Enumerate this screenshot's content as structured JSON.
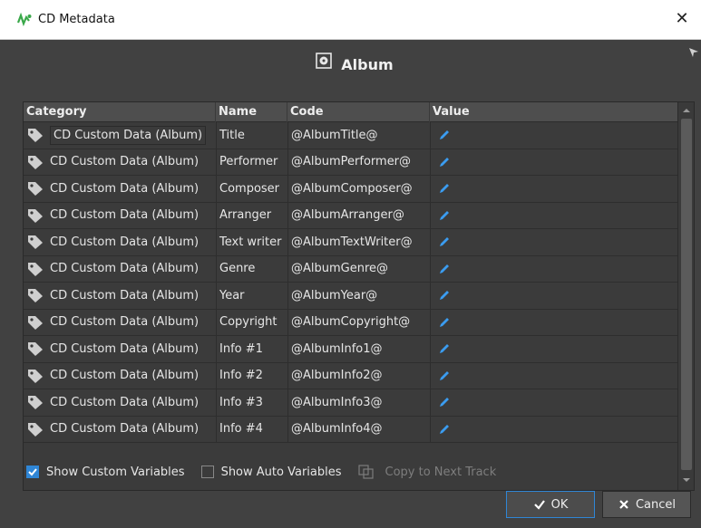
{
  "window": {
    "title": "CD Metadata",
    "close_icon": "close-icon",
    "app_icon": "wavelab-logo-icon"
  },
  "header": {
    "title": "Album",
    "icon": "album-icon"
  },
  "table": {
    "columns": [
      "Category",
      "Name",
      "Code",
      "Value"
    ],
    "rows": [
      {
        "category": "CD Custom Data (Album)",
        "name": "Title",
        "code": "@AlbumTitle@"
      },
      {
        "category": "CD Custom Data (Album)",
        "name": "Performer",
        "code": "@AlbumPerformer@"
      },
      {
        "category": "CD Custom Data (Album)",
        "name": "Composer",
        "code": "@AlbumComposer@"
      },
      {
        "category": "CD Custom Data (Album)",
        "name": "Arranger",
        "code": "@AlbumArranger@"
      },
      {
        "category": "CD Custom Data (Album)",
        "name": "Text writer",
        "code": "@AlbumTextWriter@"
      },
      {
        "category": "CD Custom Data (Album)",
        "name": "Genre",
        "code": "@AlbumGenre@"
      },
      {
        "category": "CD Custom Data (Album)",
        "name": "Year",
        "code": "@AlbumYear@"
      },
      {
        "category": "CD Custom Data (Album)",
        "name": "Copyright",
        "code": "@AlbumCopyright@"
      },
      {
        "category": "CD Custom Data (Album)",
        "name": "Info #1",
        "code": "@AlbumInfo1@"
      },
      {
        "category": "CD Custom Data (Album)",
        "name": "Info #2",
        "code": "@AlbumInfo2@"
      },
      {
        "category": "CD Custom Data (Album)",
        "name": "Info #3",
        "code": "@AlbumInfo3@"
      },
      {
        "category": "CD Custom Data (Album)",
        "name": "Info #4",
        "code": "@AlbumInfo4@"
      }
    ]
  },
  "options": {
    "show_custom_variables": {
      "label": "Show Custom Variables",
      "checked": true
    },
    "show_auto_variables": {
      "label": "Show Auto Variables",
      "checked": false
    },
    "copy_to_next_track": {
      "label": "Copy to Next Track",
      "enabled": false
    }
  },
  "buttons": {
    "ok": "OK",
    "cancel": "Cancel"
  },
  "colors": {
    "accent": "#2f86d6",
    "background": "#414141",
    "table_bg": "#3b3b3b",
    "header_bg": "#4e4e4e"
  }
}
